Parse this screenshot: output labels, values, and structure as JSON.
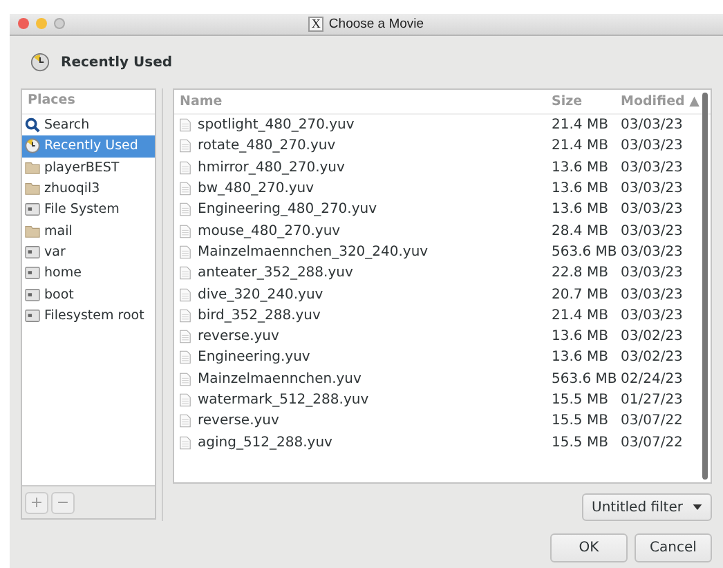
{
  "window": {
    "title": "Choose a Movie",
    "title_icon": "X"
  },
  "location": {
    "label": "Recently Used"
  },
  "places": {
    "heading": "Places",
    "items": [
      {
        "label": "Search",
        "kind": "search",
        "selected": false
      },
      {
        "label": "Recently Used",
        "kind": "recent",
        "selected": true
      },
      {
        "label": "playerBEST",
        "kind": "folder",
        "selected": false
      },
      {
        "label": "zhuoqil3",
        "kind": "folder",
        "selected": false
      },
      {
        "label": "File System",
        "kind": "drive",
        "selected": false
      },
      {
        "label": "mail",
        "kind": "folder",
        "selected": false
      },
      {
        "label": "var",
        "kind": "drive",
        "selected": false
      },
      {
        "label": "home",
        "kind": "drive",
        "selected": false
      },
      {
        "label": "boot",
        "kind": "drive",
        "selected": false
      },
      {
        "label": "Filesystem root",
        "kind": "drive",
        "selected": false
      }
    ],
    "add_button": "+",
    "remove_button": "−"
  },
  "files": {
    "columns": [
      "Name",
      "Size",
      "Modified ▲"
    ],
    "rows": [
      {
        "name": "spotlight_480_270.yuv",
        "size": "21.4 MB",
        "modified": "03/03/23"
      },
      {
        "name": "rotate_480_270.yuv",
        "size": "21.4 MB",
        "modified": "03/03/23"
      },
      {
        "name": "hmirror_480_270.yuv",
        "size": "13.6 MB",
        "modified": "03/03/23"
      },
      {
        "name": "bw_480_270.yuv",
        "size": "13.6 MB",
        "modified": "03/03/23"
      },
      {
        "name": "Engineering_480_270.yuv",
        "size": "13.6 MB",
        "modified": "03/03/23"
      },
      {
        "name": "mouse_480_270.yuv",
        "size": "28.4 MB",
        "modified": "03/03/23"
      },
      {
        "name": "Mainzelmaennchen_320_240.yuv",
        "size": "563.6 MB",
        "modified": "03/03/23"
      },
      {
        "name": "anteater_352_288.yuv",
        "size": "22.8 MB",
        "modified": "03/03/23"
      },
      {
        "name": "dive_320_240.yuv",
        "size": "20.7 MB",
        "modified": "03/03/23"
      },
      {
        "name": "bird_352_288.yuv",
        "size": "21.4 MB",
        "modified": "03/03/23"
      },
      {
        "name": "reverse.yuv",
        "size": "13.6 MB",
        "modified": "03/02/23"
      },
      {
        "name": "Engineering.yuv",
        "size": "13.6 MB",
        "modified": "03/02/23"
      },
      {
        "name": "Mainzelmaennchen.yuv",
        "size": "563.6 MB",
        "modified": "02/24/23"
      },
      {
        "name": "watermark_512_288.yuv",
        "size": "15.5 MB",
        "modified": "01/27/23"
      },
      {
        "name": "reverse.yuv",
        "size": "15.5 MB",
        "modified": "03/07/22"
      },
      {
        "name": "aging_512_288.yuv",
        "size": "15.5 MB",
        "modified": "03/07/22"
      }
    ]
  },
  "filter": {
    "label": "Untitled filter"
  },
  "buttons": [
    "OK",
    "Cancel"
  ]
}
